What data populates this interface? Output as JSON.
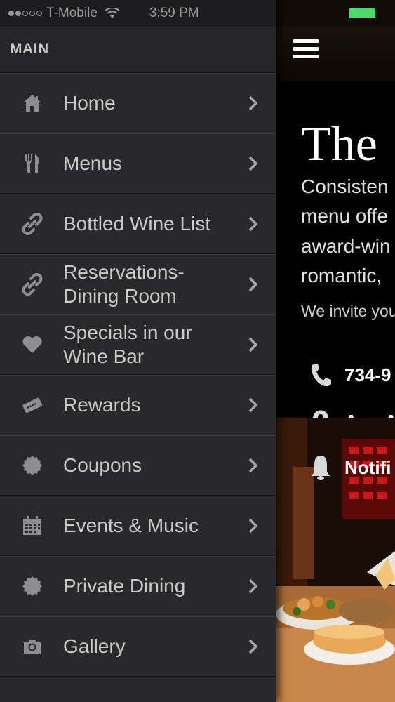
{
  "status_bar": {
    "carrier": "T-Mobile",
    "time": "3:59 PM"
  },
  "sidebar": {
    "section_title": "MAIN",
    "items": [
      {
        "label": "Home",
        "icon": "home-icon"
      },
      {
        "label": "Menus",
        "icon": "fork-knife-icon"
      },
      {
        "label": "Bottled Wine List",
        "icon": "link-icon"
      },
      {
        "label": "Reservations-\nDining Room",
        "icon": "link-icon"
      },
      {
        "label": "Specials in our\nWine Bar",
        "icon": "heart-icon"
      },
      {
        "label": "Rewards",
        "icon": "ticket-icon"
      },
      {
        "label": "Coupons",
        "icon": "badge-icon"
      },
      {
        "label": "Events & Music",
        "icon": "calendar-icon"
      },
      {
        "label": "Private Dining",
        "icon": "badge-icon"
      },
      {
        "label": "Gallery",
        "icon": "camera-icon"
      }
    ]
  },
  "content": {
    "title": "The",
    "description_lines": [
      "Consisten",
      "menu offe",
      "award-win",
      "romantic,"
    ],
    "invite": "We invite you",
    "phone": "734-9",
    "address": "Ann A",
    "notifications": "Notifi"
  },
  "colors": {
    "sidebar_bg": "#29292b",
    "text": "#c9c9c9",
    "battery": "#4cd964"
  }
}
